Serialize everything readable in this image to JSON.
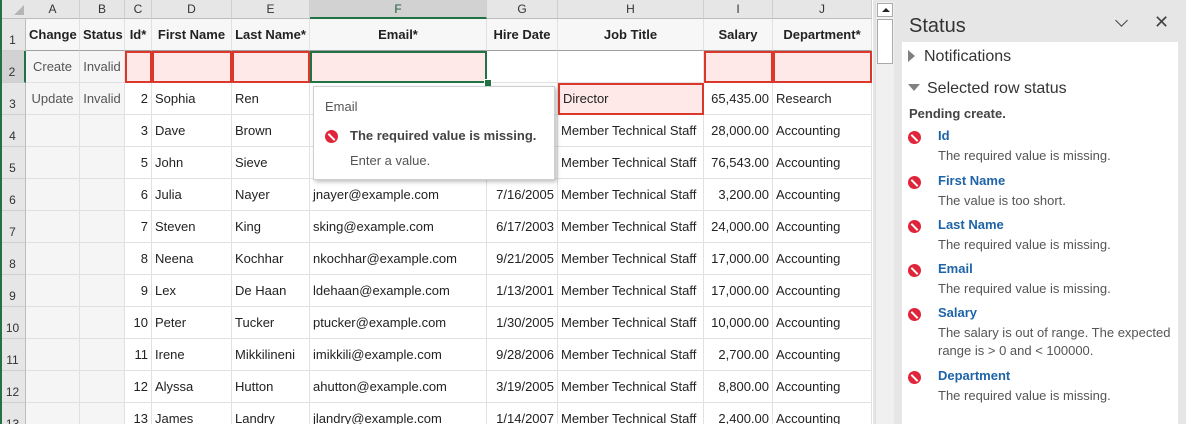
{
  "sheet": {
    "columns": [
      "A",
      "B",
      "C",
      "D",
      "E",
      "F",
      "G",
      "H",
      "I",
      "J"
    ],
    "selected_column": "F",
    "selected_row": 2,
    "header_row": [
      "Change",
      "Status",
      "Id*",
      "First Name",
      "Last Name*",
      "Email*",
      "Hire Date",
      "Job Title",
      "Salary",
      "Department*"
    ],
    "rows": [
      [
        "Create",
        "Invalid",
        "",
        "",
        "",
        "",
        "",
        "",
        "",
        ""
      ],
      [
        "Update",
        "Invalid",
        "2",
        "Sophia",
        "Ren",
        "",
        "",
        "Director",
        "65,435.00",
        "Research"
      ],
      [
        "",
        "",
        "3",
        "Dave",
        "Brown",
        "",
        "",
        "Member Technical Staff",
        "28,000.00",
        "Accounting"
      ],
      [
        "",
        "",
        "5",
        "John",
        "Sieve",
        "",
        "",
        "Member Technical Staff",
        "76,543.00",
        "Accounting"
      ],
      [
        "",
        "",
        "6",
        "Julia",
        "Nayer",
        "jnayer@example.com",
        "7/16/2005",
        "Member Technical Staff",
        "3,200.00",
        "Accounting"
      ],
      [
        "",
        "",
        "7",
        "Steven",
        "King",
        "sking@example.com",
        "6/17/2003",
        "Member Technical Staff",
        "24,000.00",
        "Accounting"
      ],
      [
        "",
        "",
        "8",
        "Neena",
        "Kochhar",
        "nkochhar@example.com",
        "9/21/2005",
        "Member Technical Staff",
        "17,000.00",
        "Accounting"
      ],
      [
        "",
        "",
        "9",
        "Lex",
        "De Haan",
        "ldehaan@example.com",
        "1/13/2001",
        "Member Technical Staff",
        "17,000.00",
        "Accounting"
      ],
      [
        "",
        "",
        "10",
        "Peter",
        "Tucker",
        "ptucker@example.com",
        "1/30/2005",
        "Member Technical Staff",
        "10,000.00",
        "Accounting"
      ],
      [
        "",
        "",
        "11",
        "Irene",
        "Mikkilineni",
        "imikkili@example.com",
        "9/28/2006",
        "Member Technical Staff",
        "2,700.00",
        "Accounting"
      ],
      [
        "",
        "",
        "12",
        "Alyssa",
        "Hutton",
        "ahutton@example.com",
        "3/19/2005",
        "Member Technical Staff",
        "8,800.00",
        "Accounting"
      ],
      [
        "",
        "",
        "13",
        "James",
        "Landry",
        "jlandry@example.com",
        "1/14/2007",
        "Member Technical Staff",
        "2,400.00",
        "Accounting"
      ]
    ],
    "accent_color": "#217346",
    "error_color": "#d9382a"
  },
  "tooltip": {
    "title": "Email",
    "message": "The required value is missing.",
    "hint": "Enter a value.",
    "icon": "error-icon"
  },
  "panel": {
    "title": "Status",
    "notifications_label": "Notifications",
    "selected_row_status_label": "Selected row status",
    "pending": "Pending create.",
    "issues": [
      {
        "field": "Id",
        "message": "The required value is missing."
      },
      {
        "field": "First Name",
        "message": "The value is too short."
      },
      {
        "field": "Last Name",
        "message": "The required value is missing."
      },
      {
        "field": "Email",
        "message": "The required value is missing."
      },
      {
        "field": "Salary",
        "message": "The salary is out of range. The expected range is > 0 and < 100000."
      },
      {
        "field": "Department",
        "message": "The required value is missing."
      }
    ]
  }
}
